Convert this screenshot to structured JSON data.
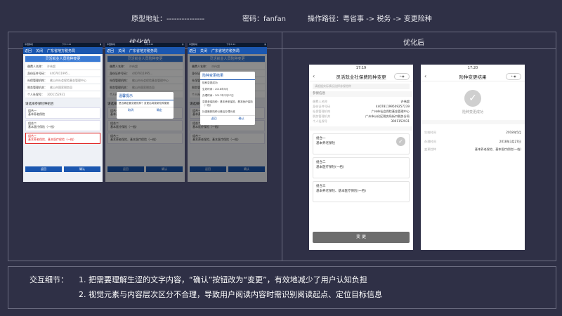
{
  "header": {
    "proto_label": "原型地址：",
    "proto_value": "---------------",
    "pwd_label": "密码：",
    "pwd_value": "fanfan",
    "path_label": "操作路径：",
    "path_value": "粤省事 -> 税务 -> 变更险种"
  },
  "panels": {
    "before": "优化前",
    "after": "优化后"
  },
  "old_screens": {
    "status_left": "中国移动",
    "time": "下午3:44",
    "nav_back": "返回",
    "nav_close": "关闭",
    "nav_title": "广东省地方税务局",
    "form_title": "灵活就业人员险种变更",
    "fields": [
      {
        "k": "缴费人名称：",
        "v": "许伟超"
      },
      {
        "k": "身份证件号码：",
        "v": "4407811995..."
      },
      {
        "k": "社保管理机构：",
        "v": "佛山市社会保险基金管理中心"
      },
      {
        "k": "税务管理机关：",
        "v": "佛山市国家税务局"
      },
      {
        "k": "个人社保号：",
        "v": "3001152931"
      }
    ],
    "choose": "请选择参保险种组合",
    "options": [
      {
        "a": "组合一",
        "b": "基本养老保险"
      },
      {
        "a": "组合二",
        "b": "基本医疗保险（一档）"
      },
      {
        "a": "组合三",
        "b": "基本养老保险、基本医疗保险（一档）"
      }
    ],
    "btn_back": "返回",
    "btn_ok": "确认",
    "dlg1": {
      "title": "温馨提示",
      "text": "是否确定要变更险种？变更后将按新险种缴费",
      "cancel": "取消",
      "ok": "确定"
    },
    "dlg2": {
      "title": "险种变更结果",
      "lines": [
        "险种变更成功",
        "生效时间：2018年5月",
        "办理时间：2017年7月27日",
        "变更参保险种：基本养老保险、基本医疗保险（一档）",
        "社保最新险种以最后办理为准"
      ],
      "back": "返回",
      "ok": "确认"
    }
  },
  "new_form": {
    "time": "17:19",
    "title": "灵活就业社保费险种变更",
    "search_ph": "请根据实际情况选择参保险种",
    "section": "参保信息",
    "rows": [
      {
        "k": "缴费人名称",
        "v": "许伟超"
      },
      {
        "k": "身份证件号码",
        "v": "440781199509257239"
      },
      {
        "k": "社保管理机构",
        "v": "广州市社会保险基金管理中心"
      },
      {
        "k": "税务管理机关",
        "v": "广州市从化区税务局街口税务分局"
      },
      {
        "k": "个人社保号",
        "v": "3001152931"
      }
    ],
    "options": [
      {
        "a": "组合一",
        "b": "基本养老保险"
      },
      {
        "a": "组合二",
        "b": "基本医疗保险(一档)"
      },
      {
        "a": "组合三",
        "b": "基本养老保险、基本医疗保险(一档)"
      }
    ],
    "submit": "变 更"
  },
  "new_result": {
    "time": "17:20",
    "title": "险种变更结果",
    "msg": "险种变更成功",
    "rows": [
      {
        "k": "生效时间",
        "v": "2018年5月"
      },
      {
        "k": "办理时间",
        "v": "2018年3月27日"
      },
      {
        "k": "变更险种",
        "v": "基本养老保险、基本医疗保险(一档)"
      }
    ]
  },
  "notes": {
    "label": "交互细节：",
    "line1": "1. 把需要理解生涩的文字内容，“确认”按钮改为“变更”，有效地减少了用户认知负担",
    "line2": "2. 视觉元素与内容层次区分不合理，导致用户阅读内容时需识别阅读起点、定位目标信息"
  },
  "colors": {
    "bg": "#2f3046",
    "old_blue": "#1b57b0",
    "red": "#e02020",
    "btn_gray": "#6d6d6d"
  }
}
